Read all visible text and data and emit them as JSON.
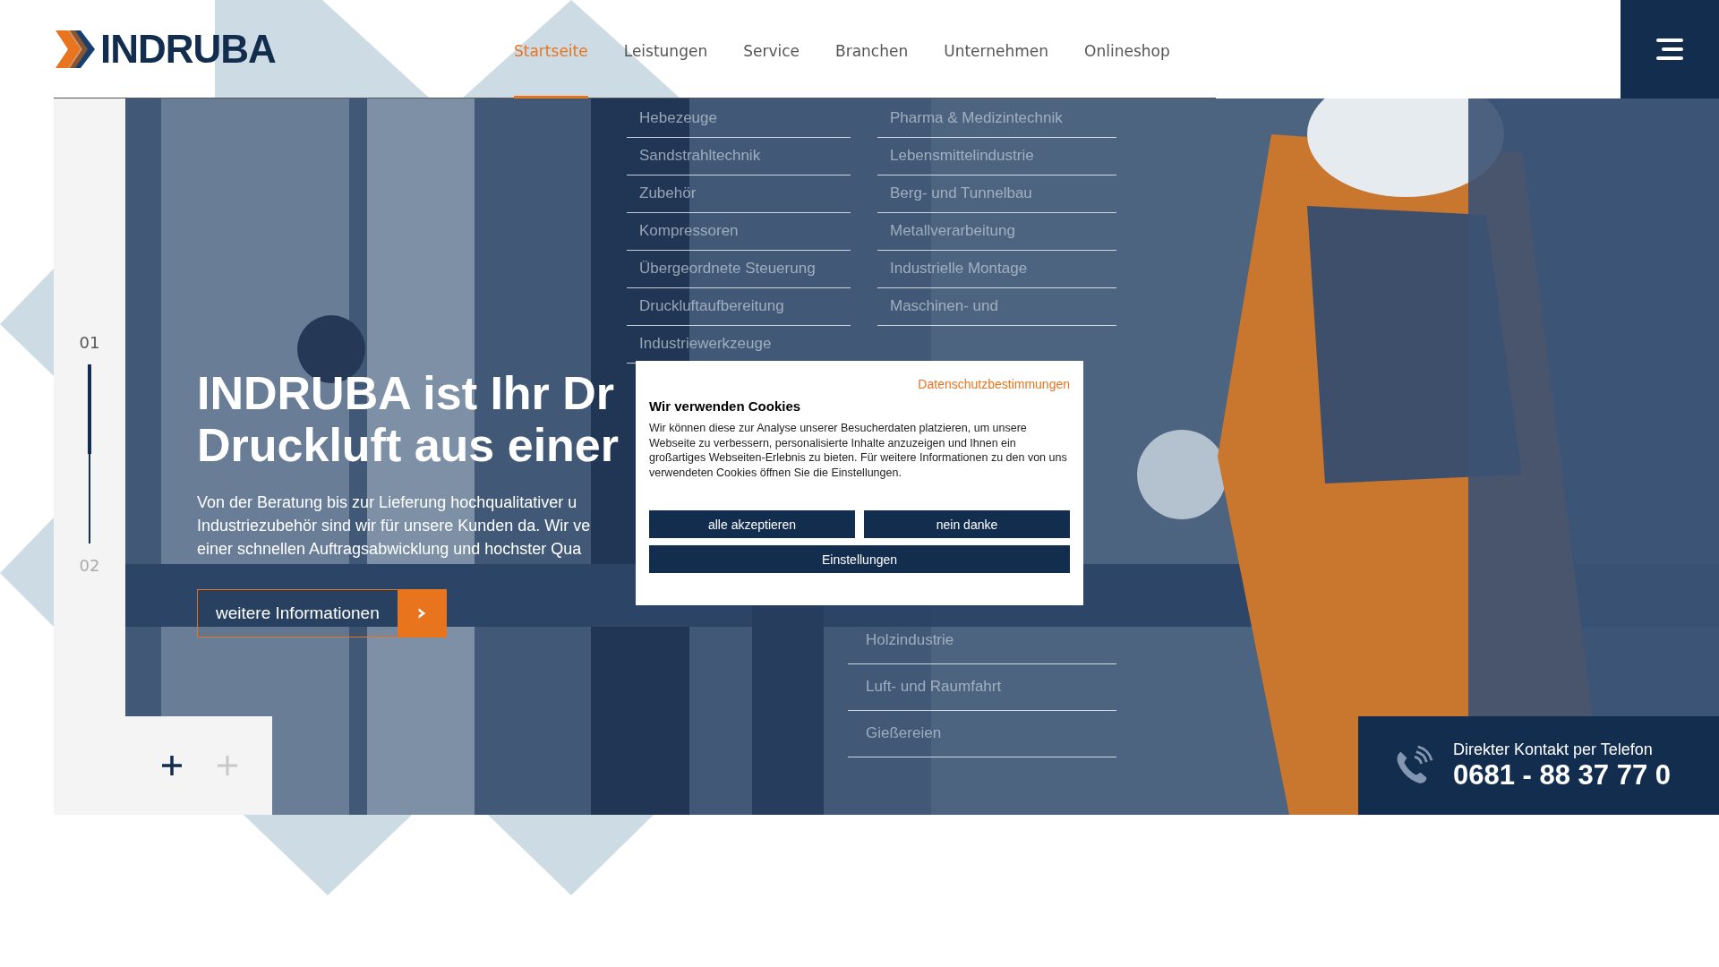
{
  "header": {
    "logo": "INDRUBA",
    "nav": [
      {
        "label": "Startseite",
        "selected": true
      },
      {
        "label": "Leistungen",
        "selected": false
      },
      {
        "label": "Service",
        "selected": false
      },
      {
        "label": "Branchen",
        "selected": false
      },
      {
        "label": "Unternehmen",
        "selected": false
      },
      {
        "label": "Onlineshop",
        "selected": false
      }
    ]
  },
  "services_menu": {
    "items": [
      "Hebezeuge",
      "Sandstrahltechnik",
      "Zubehör",
      "Kompressoren",
      "Übergeordnete Steuerung",
      "Druckluftaufbereitung",
      "Industriewerkzeuge"
    ]
  },
  "industries_menu": {
    "items_top": [
      "Pharma & Medizintechnik",
      "Lebensmittelindustrie",
      "Berg- und Tunnelbau",
      "Metallverarbeitung",
      "Industrielle Montage",
      "Maschinen- und"
    ],
    "items_bottom": [
      "Holzindustrie",
      "Luft- und Raumfahrt",
      "Gießereien"
    ]
  },
  "hero": {
    "title": "INDRUBA ist Ihr Dr\nDruckluft aus einer",
    "text": "Von der Beratung bis zur Lieferung hochqualitativer u\nIndustriezubehör sind wir für unsere Kunden da. Wir ve\neiner schnellen Auftragsabwicklung und hochster Qua",
    "button": "weitere Informationen",
    "slides": [
      {
        "label": "01",
        "selected": true
      },
      {
        "label": "02",
        "selected": false
      }
    ],
    "progress": {
      "level": 0.5
    }
  },
  "contact": {
    "label": "Direkter Kontakt per Telefon",
    "phone": "0681 - 88 37 77 0"
  },
  "cookie_dialog": {
    "link": "Datenschutzbestimmungen",
    "title": "Wir verwenden Cookies",
    "text": "Wir können diese zur Analyse unserer Besucherdaten platzieren, um unsere Webseite zu verbessern, personalisierte Inhalte anzuzeigen und Ihnen ein großartiges Webseiten-Erlebnis zu bieten. Für weitere Informationen zu den von uns verwendeten Cookies öffnen Sie die Einstellungen.",
    "buttons": [
      {
        "label": "alle akzeptieren",
        "kind": "half"
      },
      {
        "label": "nein danke",
        "kind": "half"
      },
      {
        "label": "Einstellungen",
        "kind": "full"
      }
    ]
  }
}
